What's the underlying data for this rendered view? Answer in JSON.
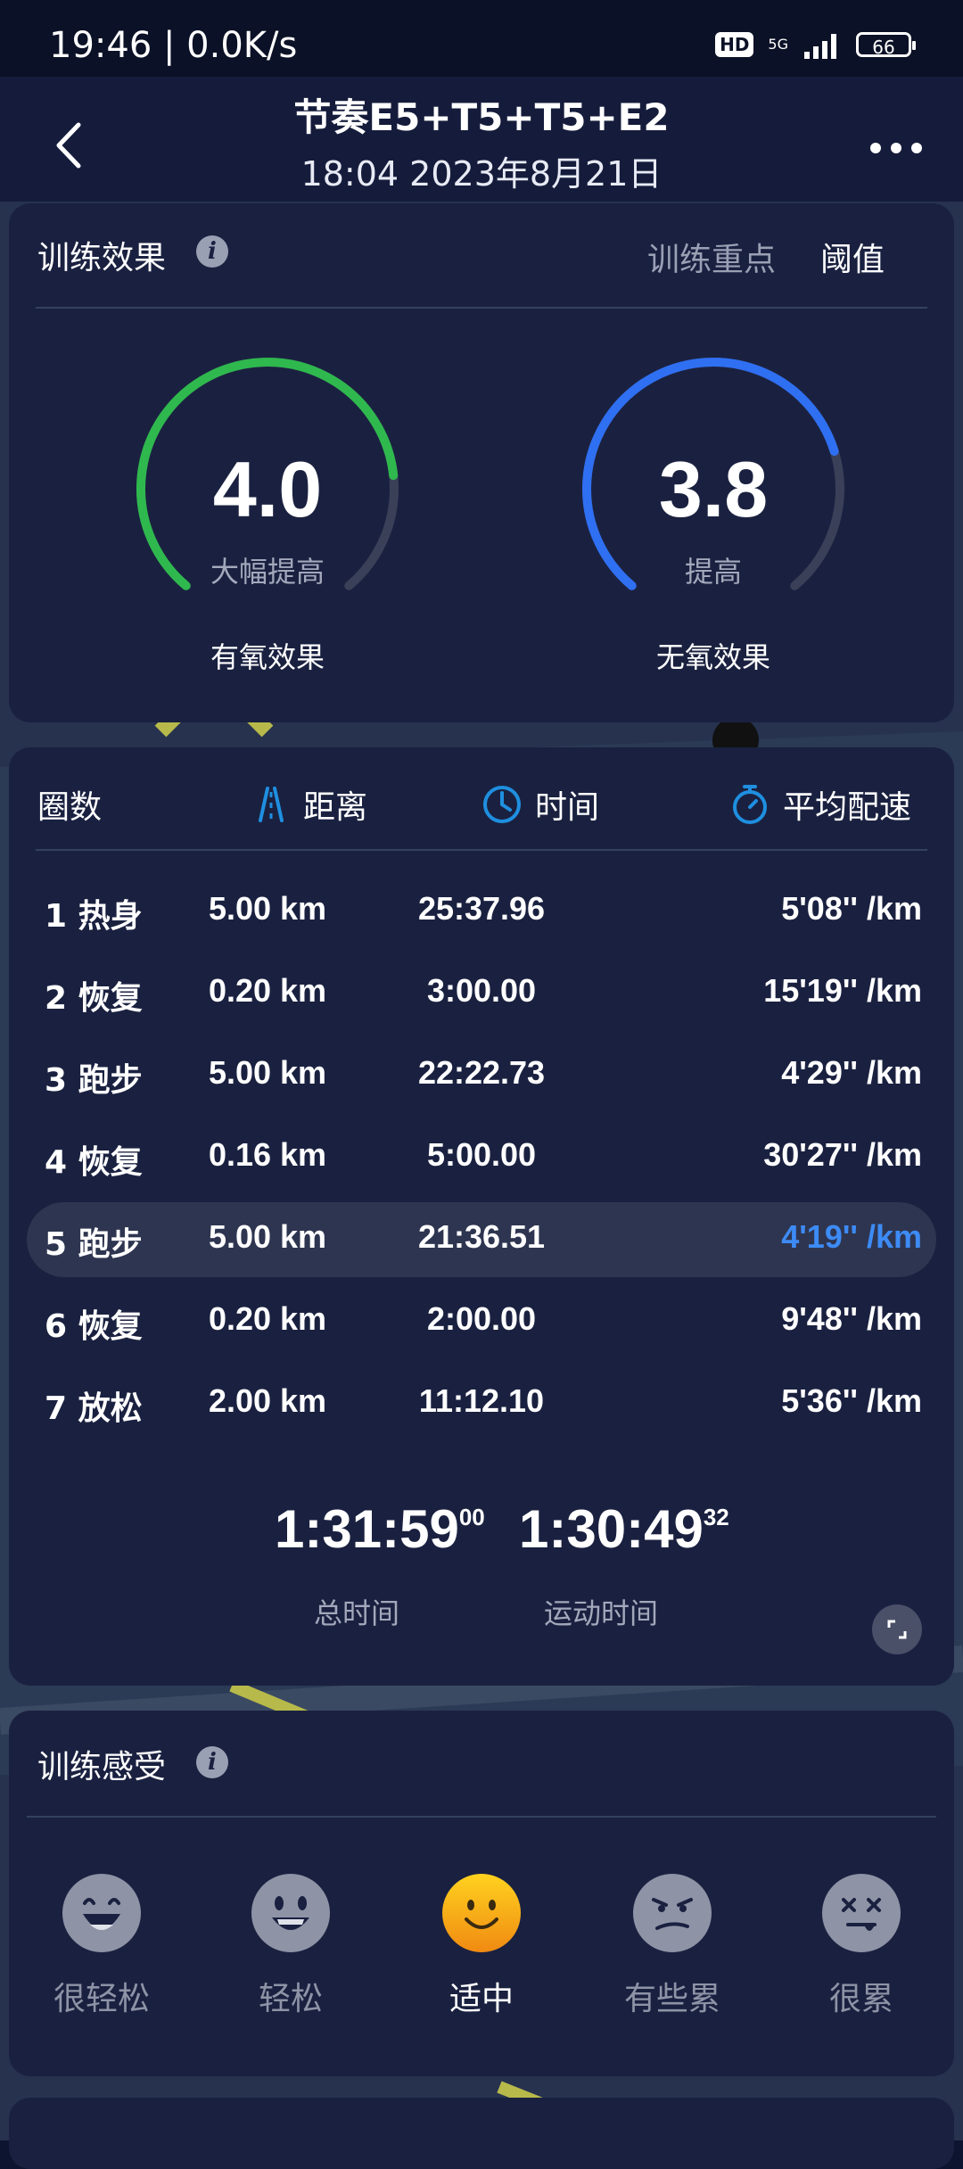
{
  "status_bar": {
    "time_speed": "19:46 | 0.0K/s",
    "hd_badge": "HD",
    "network": "5G",
    "battery": "66"
  },
  "header": {
    "title": "节奏E5+T5+T5+E2",
    "subtitle": "18:04 2023年8月21日",
    "back_icon": "chevron-left-icon",
    "more_icon": "more-dots-icon"
  },
  "training_effect": {
    "title": "训练效果",
    "info_icon": "info-icon",
    "focus_label": "训练重点",
    "focus_value": "阈值",
    "aerobic": {
      "value": "4.0",
      "level": "大幅提高",
      "name": "有氧效果",
      "fill_fraction": 0.8,
      "color": "#2fb84e"
    },
    "anaerobic": {
      "value": "3.8",
      "level": "提高",
      "name": "无氧效果",
      "fill_fraction": 0.76,
      "color": "#2f6ff2"
    }
  },
  "laps": {
    "headers": {
      "lap": "圈数",
      "distance": "距离",
      "time": "时间",
      "pace": "平均配速"
    },
    "header_icons": [
      "road-icon",
      "clock-icon",
      "stopwatch-icon"
    ],
    "accent_color": "#1f8fe0",
    "rows": [
      {
        "name": "1 热身",
        "distance": "5.00 km",
        "time": "25:37.96",
        "pace": "5'08'' /km"
      },
      {
        "name": "2 恢复",
        "distance": "0.20 km",
        "time": "3:00.00",
        "pace": "15'19'' /km"
      },
      {
        "name": "3 跑步",
        "distance": "5.00 km",
        "time": "22:22.73",
        "pace": "4'29'' /km"
      },
      {
        "name": "4 恢复",
        "distance": "0.16 km",
        "time": "5:00.00",
        "pace": "30'27'' /km"
      },
      {
        "name": "5 跑步",
        "distance": "5.00 km",
        "time": "21:36.51",
        "pace": "4'19'' /km"
      },
      {
        "name": "6 恢复",
        "distance": "0.20 km",
        "time": "2:00.00",
        "pace": "9'48'' /km"
      },
      {
        "name": "7 放松",
        "distance": "2.00 km",
        "time": "11:12.10",
        "pace": "5'36'' /km"
      }
    ],
    "highlight_color": "#3d8bf5",
    "total_time": {
      "main": "1:31:59",
      "fraction": "00",
      "label": "总时间"
    },
    "moving_time": {
      "main": "1:30:49",
      "fraction": "32",
      "label": "运动时间"
    },
    "expand_icon": "expand-icon"
  },
  "feeling": {
    "title": "训练感受",
    "info_icon": "info-icon",
    "options": [
      {
        "label": "很轻松",
        "icon": "laughing-face-icon"
      },
      {
        "label": "轻松",
        "icon": "smiling-face-icon"
      },
      {
        "label": "适中",
        "icon": "content-face-icon",
        "selected": true
      },
      {
        "label": "有些累",
        "icon": "tired-face-icon"
      },
      {
        "label": "很累",
        "icon": "exhausted-face-icon"
      }
    ]
  }
}
